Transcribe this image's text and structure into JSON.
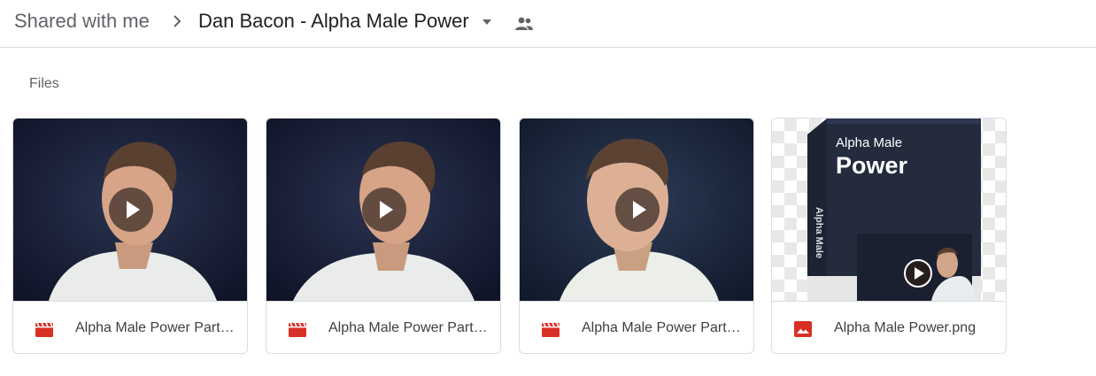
{
  "breadcrumb": {
    "root": "Shared with me",
    "current": "Dan Bacon - Alpha Male Power"
  },
  "section": {
    "title": "Files"
  },
  "files": [
    {
      "name": "Alpha Male Power Part…",
      "type": "video-icon"
    },
    {
      "name": "Alpha Male Power Part…",
      "type": "video-icon"
    },
    {
      "name": "Alpha Male Power Part…",
      "type": "video-icon"
    },
    {
      "name": "Alpha Male Power.png",
      "type": "image-icon"
    }
  ],
  "product_box": {
    "brand": "Alpha Male",
    "title": "Power",
    "spine": "Alpha Male"
  },
  "colors": {
    "video_icon": "#d93025",
    "image_icon": "#d93025",
    "border": "#dadce0"
  }
}
